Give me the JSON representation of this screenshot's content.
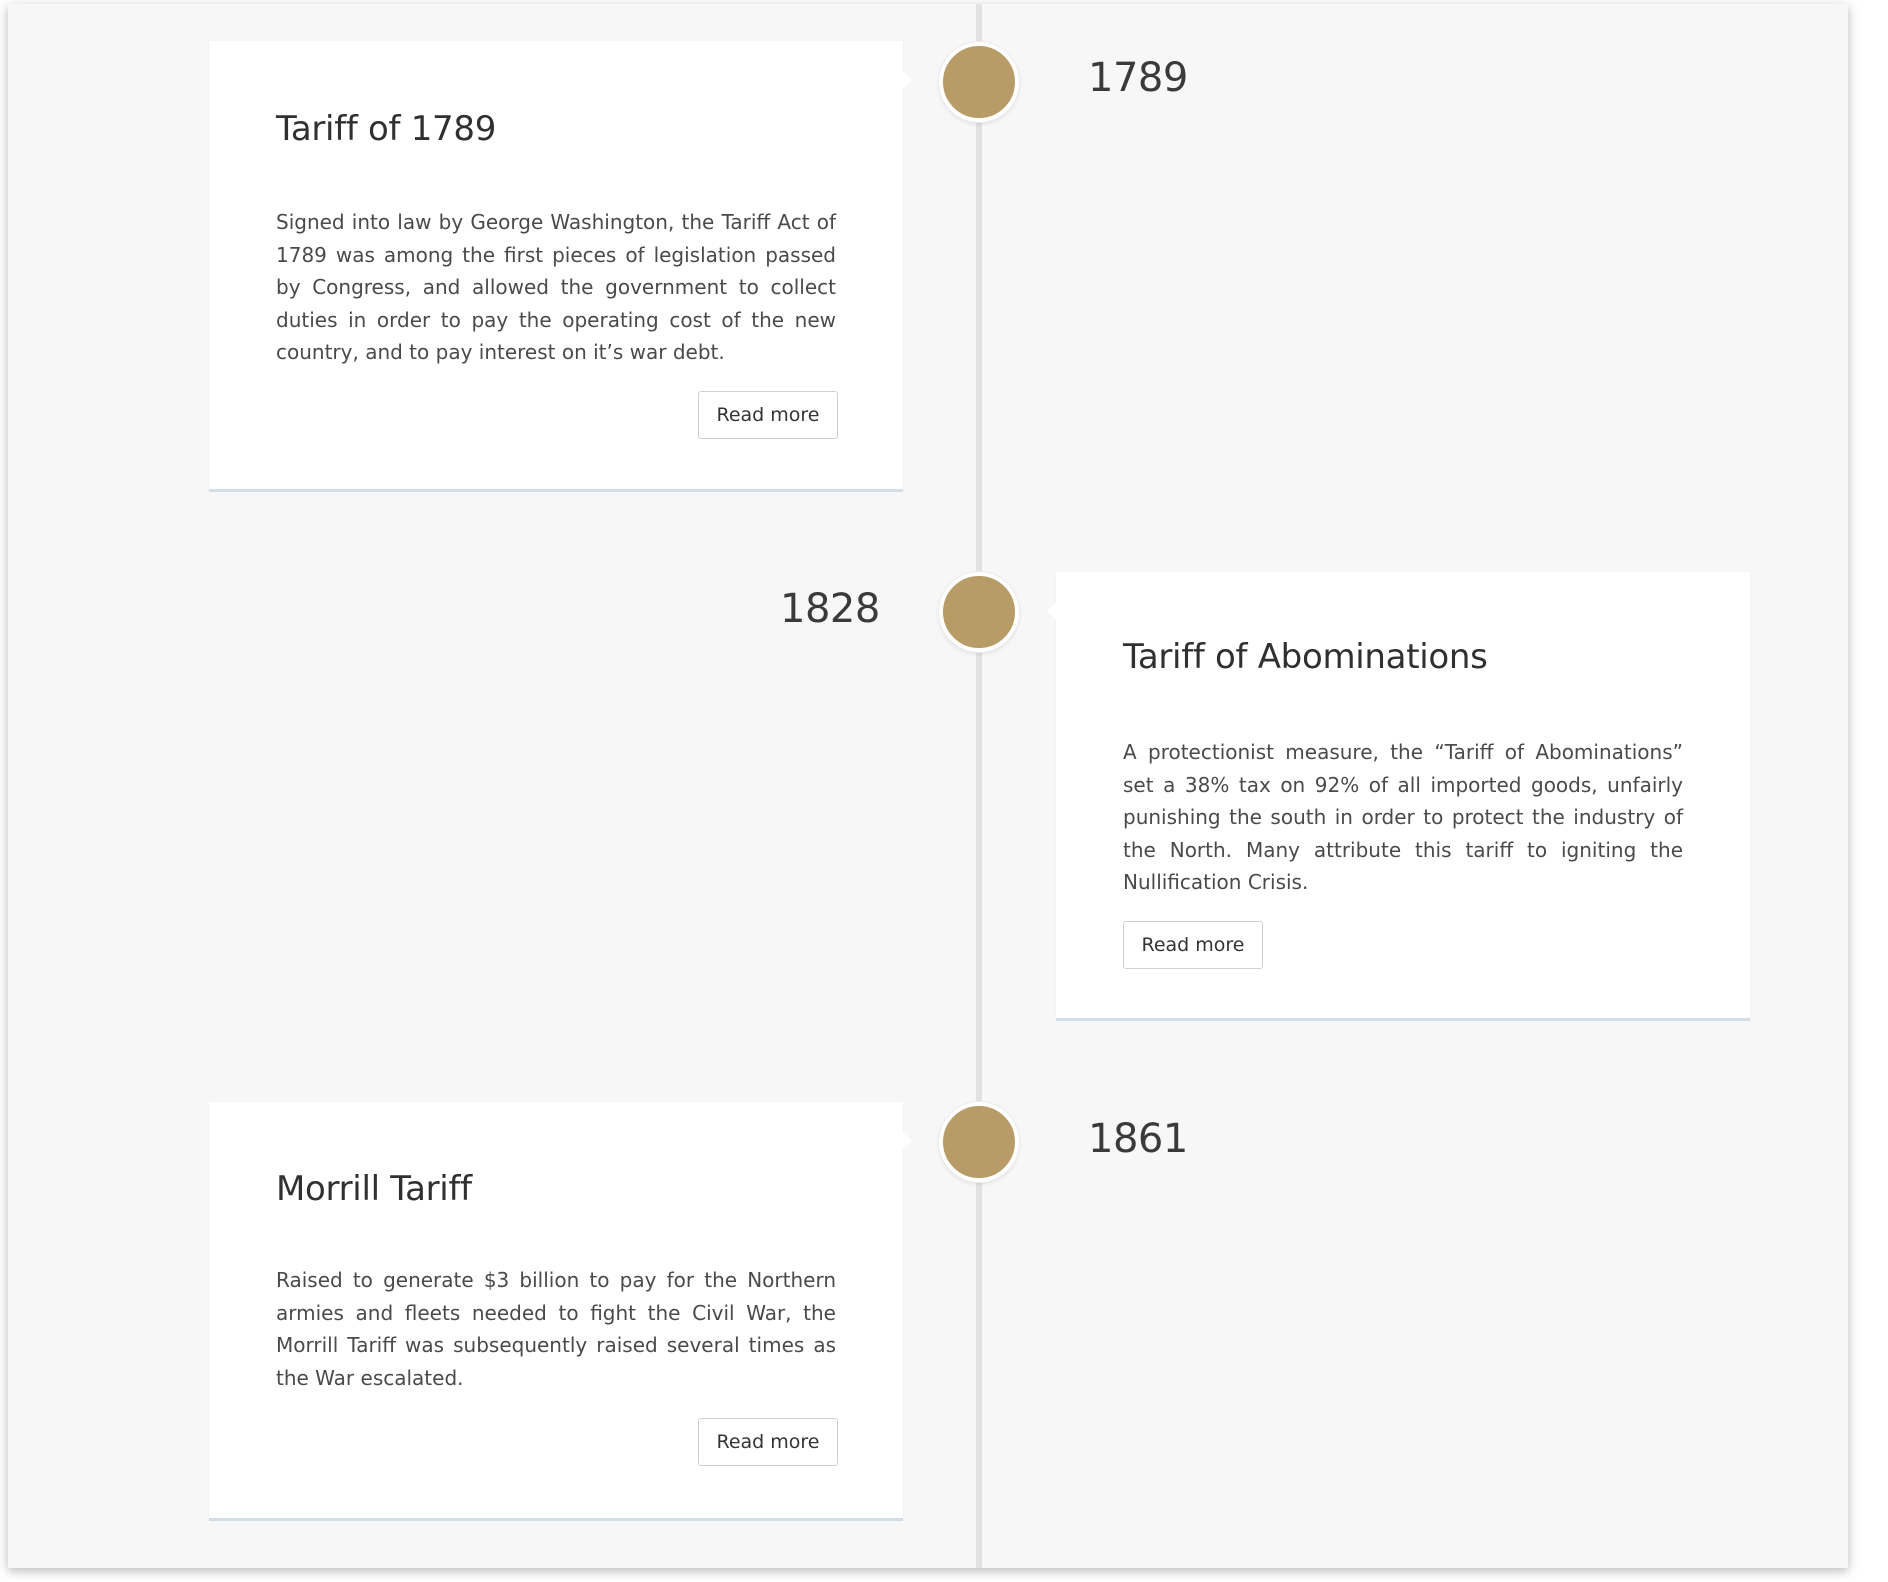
{
  "timeline": {
    "events": [
      {
        "date": "1789",
        "title": "Tariff of 1789",
        "body": "Signed into law by George Washington, the Tariff Act of 1789 was among the first pieces of legislation passed by Congress, and allowed the government to collect duties in order to pay the operating cost of the new country, and to pay interest on it’s war debt.",
        "read_more": "Read more"
      },
      {
        "date": "1828",
        "title": "Tariff of Abominations",
        "body": "A protectionist measure, the “Tariff of Abominations” set a 38% tax on 92% of all imported goods, unfairly punishing the south in order to protect the industry of the North. Many attribute this tariff to igniting the Nullification Crisis.",
        "read_more": "Read more"
      },
      {
        "date": "1861",
        "title": "Morrill Tariff",
        "body": "Raised to generate $3 billion to pay for the Northern armies and fleets needed to fight the Civil War, the Morrill Tariff was subsequently raised several times as the War escalated.",
        "read_more": "Read more"
      }
    ]
  },
  "colors": {
    "node": "#b79c68",
    "background": "#f7f7f7",
    "card": "#ffffff",
    "line": "#e2e2e2"
  }
}
